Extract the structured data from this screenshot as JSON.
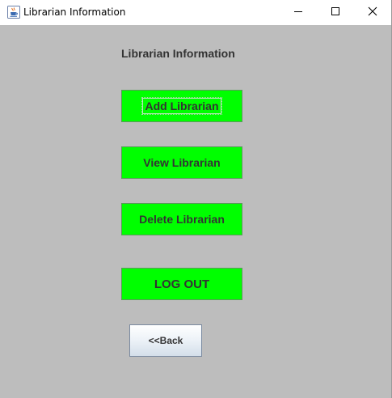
{
  "window": {
    "title": "Librarian Information",
    "icon": "java-cup-icon",
    "controls": [
      "minimize-icon",
      "maximize-icon",
      "close-icon"
    ]
  },
  "main": {
    "heading": "Librarian Information",
    "buttons": {
      "add": "Add Librarian",
      "view": "View Librarian",
      "delete": "Delete Librarian",
      "logout": "LOG OUT",
      "back": "<<Back"
    }
  },
  "colors": {
    "background": "#bdbdbd",
    "button_green": "#00ff00",
    "text": "#333333"
  }
}
